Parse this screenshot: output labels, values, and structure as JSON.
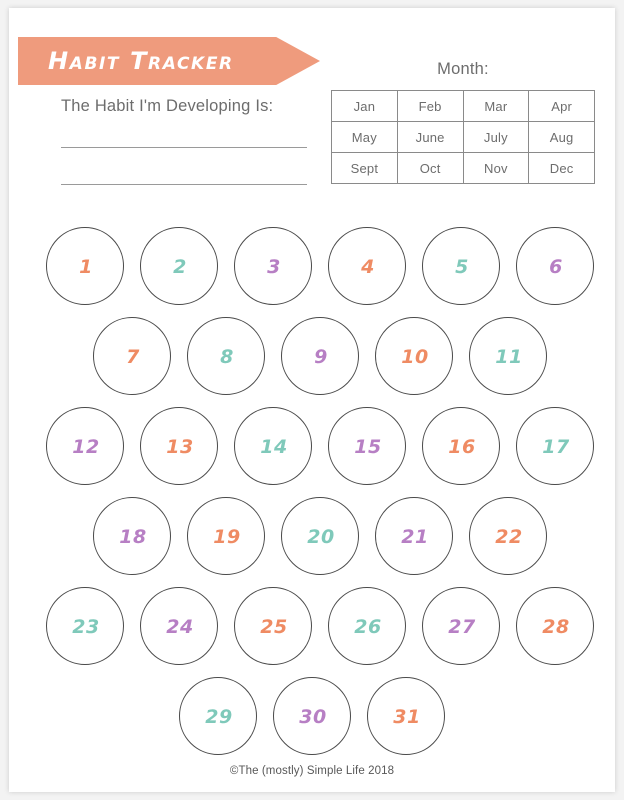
{
  "page": {
    "title": "Habit Tracker",
    "footer": "©The (mostly) Simple Life 2018"
  },
  "habit": {
    "prompt": "The Habit I'm Developing Is:",
    "line_1_value": "",
    "line_2_value": ""
  },
  "month": {
    "label": "Month:",
    "rows": [
      [
        "Jan",
        "Feb",
        "Mar",
        "Apr"
      ],
      [
        "May",
        "June",
        "July",
        "Aug"
      ],
      [
        "Sept",
        "Oct",
        "Nov",
        "Dec"
      ]
    ]
  },
  "colors": {
    "banner": "#ef9b7d",
    "orange": "#ef8b63",
    "teal": "#7fc9ba",
    "purple": "#b77fc4",
    "circle_stroke": "#4a4a4a",
    "text_gray": "#6d6d6d"
  },
  "tracker": {
    "rows": [
      {
        "offset": false,
        "days": [
          {
            "n": "1",
            "color": "orange"
          },
          {
            "n": "2",
            "color": "teal"
          },
          {
            "n": "3",
            "color": "purple"
          },
          {
            "n": "4",
            "color": "orange"
          },
          {
            "n": "5",
            "color": "teal"
          },
          {
            "n": "6",
            "color": "purple"
          }
        ]
      },
      {
        "offset": true,
        "days": [
          {
            "n": "7",
            "color": "orange"
          },
          {
            "n": "8",
            "color": "teal"
          },
          {
            "n": "9",
            "color": "purple"
          },
          {
            "n": "10",
            "color": "orange"
          },
          {
            "n": "11",
            "color": "teal"
          }
        ]
      },
      {
        "offset": false,
        "days": [
          {
            "n": "12",
            "color": "purple"
          },
          {
            "n": "13",
            "color": "orange"
          },
          {
            "n": "14",
            "color": "teal"
          },
          {
            "n": "15",
            "color": "purple"
          },
          {
            "n": "16",
            "color": "orange"
          },
          {
            "n": "17",
            "color": "teal"
          }
        ]
      },
      {
        "offset": true,
        "days": [
          {
            "n": "18",
            "color": "purple"
          },
          {
            "n": "19",
            "color": "orange"
          },
          {
            "n": "20",
            "color": "teal"
          },
          {
            "n": "21",
            "color": "purple"
          },
          {
            "n": "22",
            "color": "orange"
          }
        ]
      },
      {
        "offset": false,
        "days": [
          {
            "n": "23",
            "color": "teal"
          },
          {
            "n": "24",
            "color": "purple"
          },
          {
            "n": "25",
            "color": "orange"
          },
          {
            "n": "26",
            "color": "teal"
          },
          {
            "n": "27",
            "color": "purple"
          },
          {
            "n": "28",
            "color": "orange"
          }
        ]
      },
      {
        "offset": false,
        "centered": true,
        "days": [
          {
            "n": "29",
            "color": "teal"
          },
          {
            "n": "30",
            "color": "purple"
          },
          {
            "n": "31",
            "color": "orange"
          }
        ]
      }
    ]
  }
}
